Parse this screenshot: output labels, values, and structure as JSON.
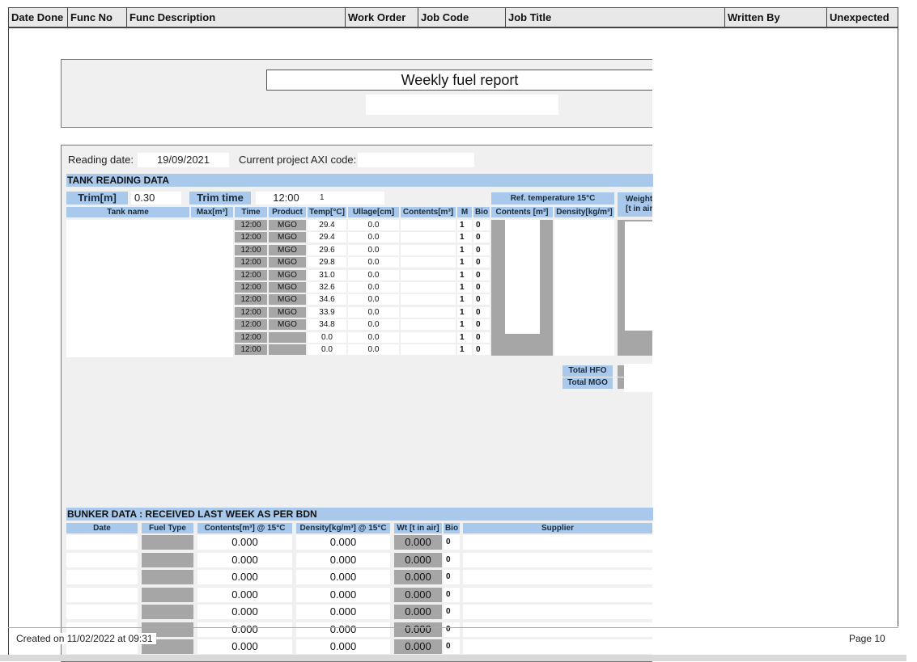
{
  "header_columns": [
    {
      "label": "Date Done"
    },
    {
      "label": "Func No"
    },
    {
      "label": "Func Description"
    },
    {
      "label": "Work Order"
    },
    {
      "label": "Job Code"
    },
    {
      "label": "Job Title"
    },
    {
      "label": "Written By"
    },
    {
      "label": "Unexpected"
    }
  ],
  "report": {
    "title": "Weekly fuel report",
    "reading_date_label": "Reading date:",
    "reading_date": "19/09/2021",
    "axi_code_label": "Current project AXI code:",
    "axi_code": ""
  },
  "tank": {
    "section_title": "TANK READING DATA",
    "trim_label": "Trim[m]",
    "trim_value": "0.30",
    "trim_time_label": "Trim time",
    "trim_time_value": "12:00",
    "trim_extra": "1",
    "ref_temp_label": "Ref. temperature 15°C",
    "weight_label_1": "Weight",
    "weight_label_2": "[t in air",
    "columns": {
      "tank_name": "Tank name",
      "max": "Max[m³]",
      "time": "Time",
      "product": "Product",
      "temp": "Temp[°C]",
      "ullage": "Ullage[cm]",
      "contents": "Contents[m³]",
      "m": "M",
      "bio": "Bio",
      "ref_contents": "Contents [m³]",
      "density": "Density[kg/m³]"
    },
    "rows": [
      {
        "time": "12:00",
        "product": "MGO",
        "temp": "29.4",
        "ullage": "0.0",
        "m": "1",
        "bio": "0"
      },
      {
        "time": "12:00",
        "product": "MGO",
        "temp": "29.4",
        "ullage": "0.0",
        "m": "1",
        "bio": "0"
      },
      {
        "time": "12:00",
        "product": "MGO",
        "temp": "29.6",
        "ullage": "0.0",
        "m": "1",
        "bio": "0"
      },
      {
        "time": "12:00",
        "product": "MGO",
        "temp": "29.8",
        "ullage": "0.0",
        "m": "1",
        "bio": "0"
      },
      {
        "time": "12:00",
        "product": "MGO",
        "temp": "31.0",
        "ullage": "0.0",
        "m": "1",
        "bio": "0"
      },
      {
        "time": "12:00",
        "product": "MGO",
        "temp": "32.6",
        "ullage": "0.0",
        "m": "1",
        "bio": "0"
      },
      {
        "time": "12:00",
        "product": "MGO",
        "temp": "34.6",
        "ullage": "0.0",
        "m": "1",
        "bio": "0"
      },
      {
        "time": "12:00",
        "product": "MGO",
        "temp": "33.9",
        "ullage": "0.0",
        "m": "1",
        "bio": "0"
      },
      {
        "time": "12:00",
        "product": "MGO",
        "temp": "34.8",
        "ullage": "0.0",
        "m": "1",
        "bio": "0"
      },
      {
        "time": "12:00",
        "product": "",
        "temp": "0.0",
        "ullage": "0.0",
        "m": "1",
        "bio": "0"
      },
      {
        "time": "12:00",
        "product": "",
        "temp": "0.0",
        "ullage": "0.0",
        "m": "1",
        "bio": "0"
      }
    ],
    "total_hfo_label": "Total HFO",
    "total_mgo_label": "Total MGO"
  },
  "bunker": {
    "section_title": "BUNKER DATA : RECEIVED LAST WEEK AS PER BDN",
    "columns": {
      "date": "Date",
      "fuel_type": "Fuel Type",
      "contents": "Contents[m³] @ 15°C",
      "density": "Density[kg/m³] @ 15°C",
      "wt": "Wt [t in air]",
      "bio": "Bio",
      "supplier": "Supplier"
    },
    "rows": [
      {
        "contents": "0.000",
        "density": "0.000",
        "wt": "0.000",
        "bio": "0"
      },
      {
        "contents": "0.000",
        "density": "0.000",
        "wt": "0.000",
        "bio": "0"
      },
      {
        "contents": "0.000",
        "density": "0.000",
        "wt": "0.000",
        "bio": "0"
      },
      {
        "contents": "0.000",
        "density": "0.000",
        "wt": "0.000",
        "bio": "0"
      },
      {
        "contents": "0.000",
        "density": "0.000",
        "wt": "0.000",
        "bio": "0"
      },
      {
        "contents": "0.000",
        "density": "0.000",
        "wt": "0.000",
        "bio": "0"
      },
      {
        "contents": "0.000",
        "density": "0.000",
        "wt": "0.000",
        "bio": "0"
      }
    ]
  },
  "footer": {
    "created": "Created on 11/02/2022 at 09:31",
    "page": "Page 10"
  }
}
